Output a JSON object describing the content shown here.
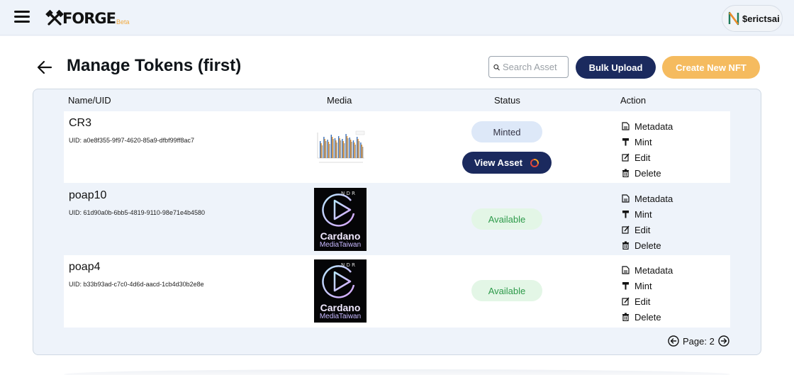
{
  "header": {
    "logo_text": "FORGE",
    "logo_badge": "Beta",
    "user_name": "$erictsai",
    "menu_icon": "hamburger-icon",
    "logo_icon": "crossed-hammers-icon",
    "user_icon": "n-brand-icon"
  },
  "page": {
    "title": "Manage Tokens (first)",
    "back_icon": "arrow-left-icon"
  },
  "toolbar": {
    "search_placeholder": "Search Asset",
    "search_value": "",
    "bulk_upload_label": "Bulk Upload",
    "create_nft_label": "Create New NFT"
  },
  "table": {
    "columns": [
      "Name/UID",
      "Media",
      "Status",
      "Action"
    ],
    "action_labels": {
      "metadata": "Metadata",
      "mint": "Mint",
      "edit": "Edit",
      "delete": "Delete"
    },
    "rows": [
      {
        "name": "CR3",
        "uid": "UID: a0e8f355-9f97-4620-85a9-dfbf99ff8ac7",
        "media": "bar-chart-thumbnail",
        "status": "Minted",
        "view_asset_label": "View Asset"
      },
      {
        "name": "poap10",
        "uid": "UID: 61d90a0b-6bb5-4819-9110-98e71e4b4580",
        "media": "cardano-nft-image",
        "media_text_main": "Cardano",
        "media_text_sub": "MediaTaiwan",
        "status": "Available"
      },
      {
        "name": "poap4",
        "uid": "UID: b33b93ad-c7c0-4d6d-aacd-1cb4d30b2e8e",
        "media": "cardano-nft-image",
        "media_text_main": "Cardano",
        "media_text_sub": "MediaTaiwan",
        "status": "Available"
      }
    ]
  },
  "pagination": {
    "label": "Page: 2",
    "prev_icon": "circle-arrow-left-icon",
    "next_icon": "circle-arrow-right-icon"
  },
  "colors": {
    "primary": "#1b2a5e",
    "accent": "#f5bb5f",
    "available": "#2d9a4a",
    "minted_bg": "#dde8f8"
  }
}
